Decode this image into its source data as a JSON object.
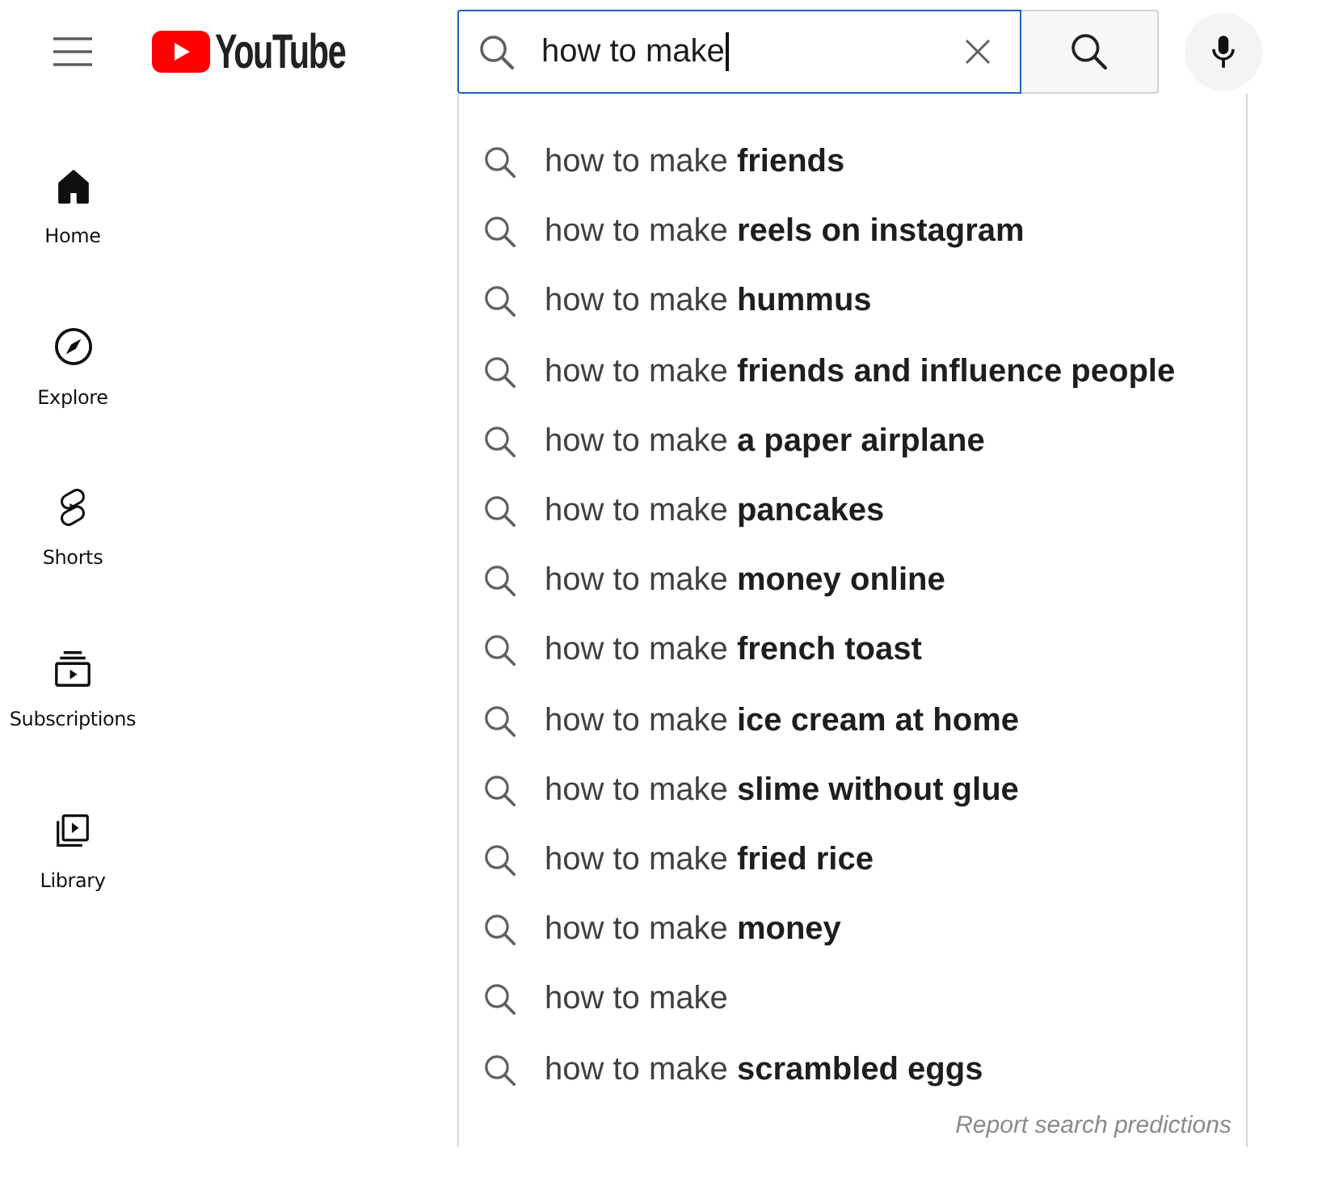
{
  "header": {
    "logo": {
      "text": "YouTube"
    },
    "search": {
      "value": "how to make",
      "focused": true
    }
  },
  "sidebar": {
    "items": [
      {
        "label": "Home",
        "selected": true
      },
      {
        "label": "Explore",
        "selected": false
      },
      {
        "label": "Shorts",
        "selected": false
      },
      {
        "label": "Subscriptions",
        "selected": false
      },
      {
        "label": "Library",
        "selected": false
      }
    ]
  },
  "suggestions": {
    "items": [
      {
        "text": "how to make **friends**"
      },
      {
        "text": "how to make **reels on instagram**"
      },
      {
        "text": "how to make **hummus**"
      },
      {
        "text": "how to make **friends and influence people**"
      },
      {
        "text": "how to make **a paper airplane**"
      },
      {
        "text": "how to make **pancakes**"
      },
      {
        "text": "how to make **money online**"
      },
      {
        "text": "how to make **french toast**"
      },
      {
        "text": "how to make **ice cream at home**"
      },
      {
        "text": "how to make **slime without glue**"
      },
      {
        "text": "how to make **fried rice**"
      },
      {
        "text": "how to make **money**"
      },
      {
        "text": "how to make"
      },
      {
        "text": "how to make **scrambled eggs**"
      }
    ],
    "report_link": "Report search predictions"
  }
}
